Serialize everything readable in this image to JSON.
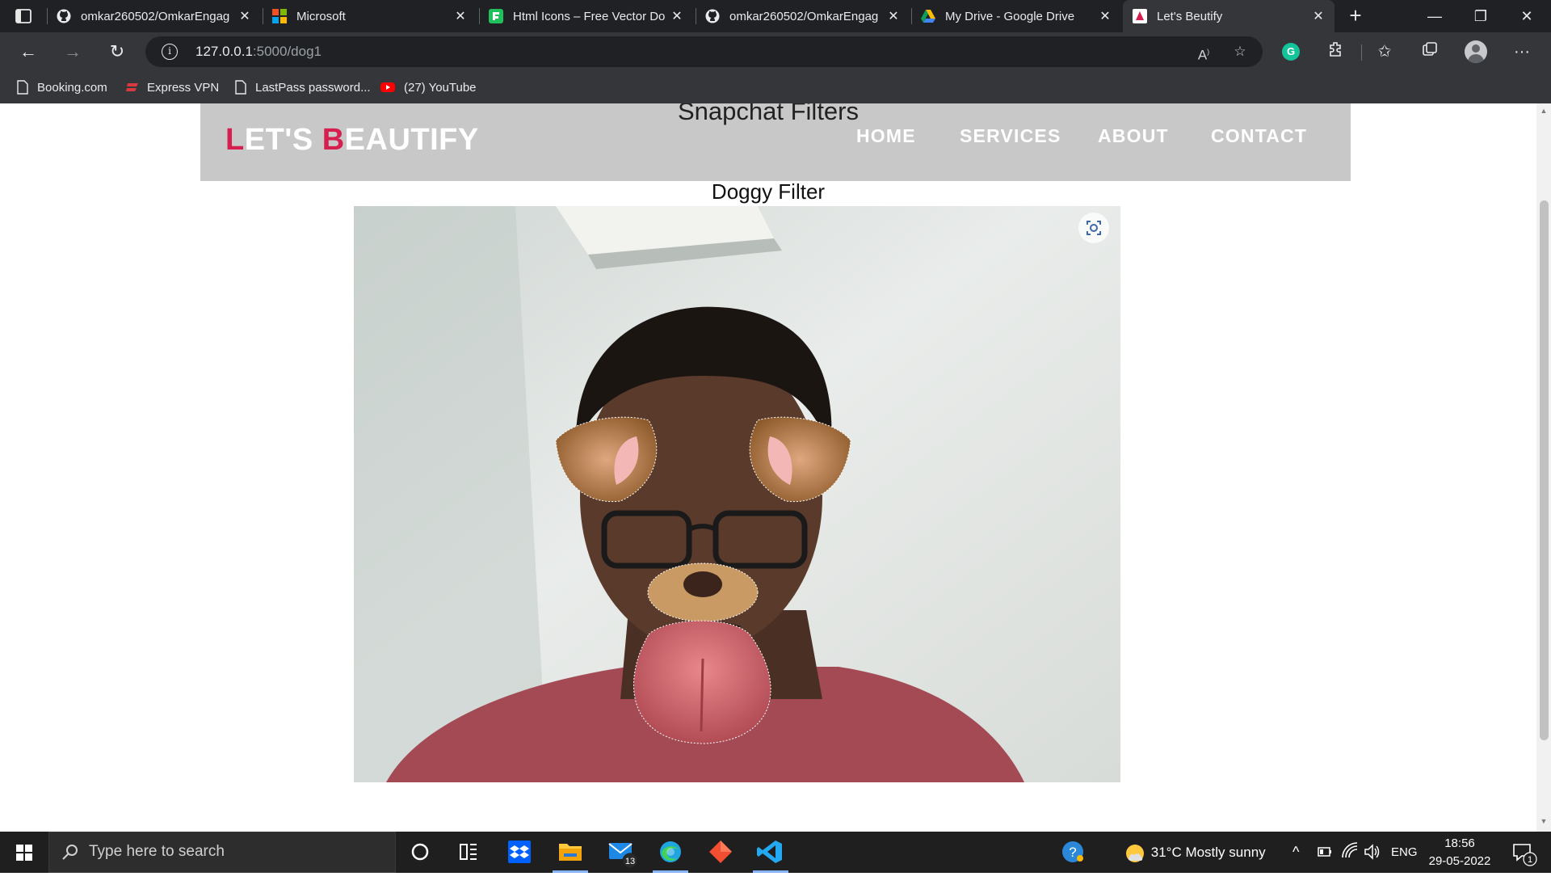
{
  "browser": {
    "tabs": [
      {
        "label": "omkar260502/OmkarEngag",
        "icon": "github-icon",
        "active": false
      },
      {
        "label": "Microsoft",
        "icon": "microsoft-icon",
        "active": false
      },
      {
        "label": "Html Icons – Free Vector Do",
        "icon": "flaticon-icon",
        "active": false
      },
      {
        "label": "omkar260502/OmkarEngag",
        "icon": "github-icon",
        "active": false
      },
      {
        "label": "My Drive - Google Drive",
        "icon": "google-drive-icon",
        "active": false
      },
      {
        "label": "Let's Beutify",
        "icon": "site-favicon",
        "active": true
      }
    ],
    "url_host": "127.0.0.1",
    "url_path": ":5000/dog1",
    "bookmarks": [
      {
        "label": "Booking.com",
        "icon": "page-icon"
      },
      {
        "label": "Express VPN",
        "icon": "expressvpn-icon"
      },
      {
        "label": "LastPass password...",
        "icon": "page-icon"
      },
      {
        "label": "(27) YouTube",
        "icon": "youtube-icon"
      }
    ]
  },
  "page": {
    "brand_first_L": "L",
    "brand_part1": "ET'S ",
    "brand_first_B": "B",
    "brand_part2": "EAUTIFY",
    "title": "Snapchat Filters",
    "nav": [
      "HOME",
      "SERVICES",
      "ABOUT",
      "CONTACT"
    ],
    "filter_title": "Doggy Filter",
    "brand_accent": "#d61f4e",
    "header_bg": "#c8c8c8"
  },
  "taskbar": {
    "search_placeholder": "Type here to search",
    "mail_badge": "13",
    "weather": "31°C  Mostly sunny",
    "language": "ENG",
    "time": "18:56",
    "date": "29-05-2022",
    "notification_count": "1"
  }
}
